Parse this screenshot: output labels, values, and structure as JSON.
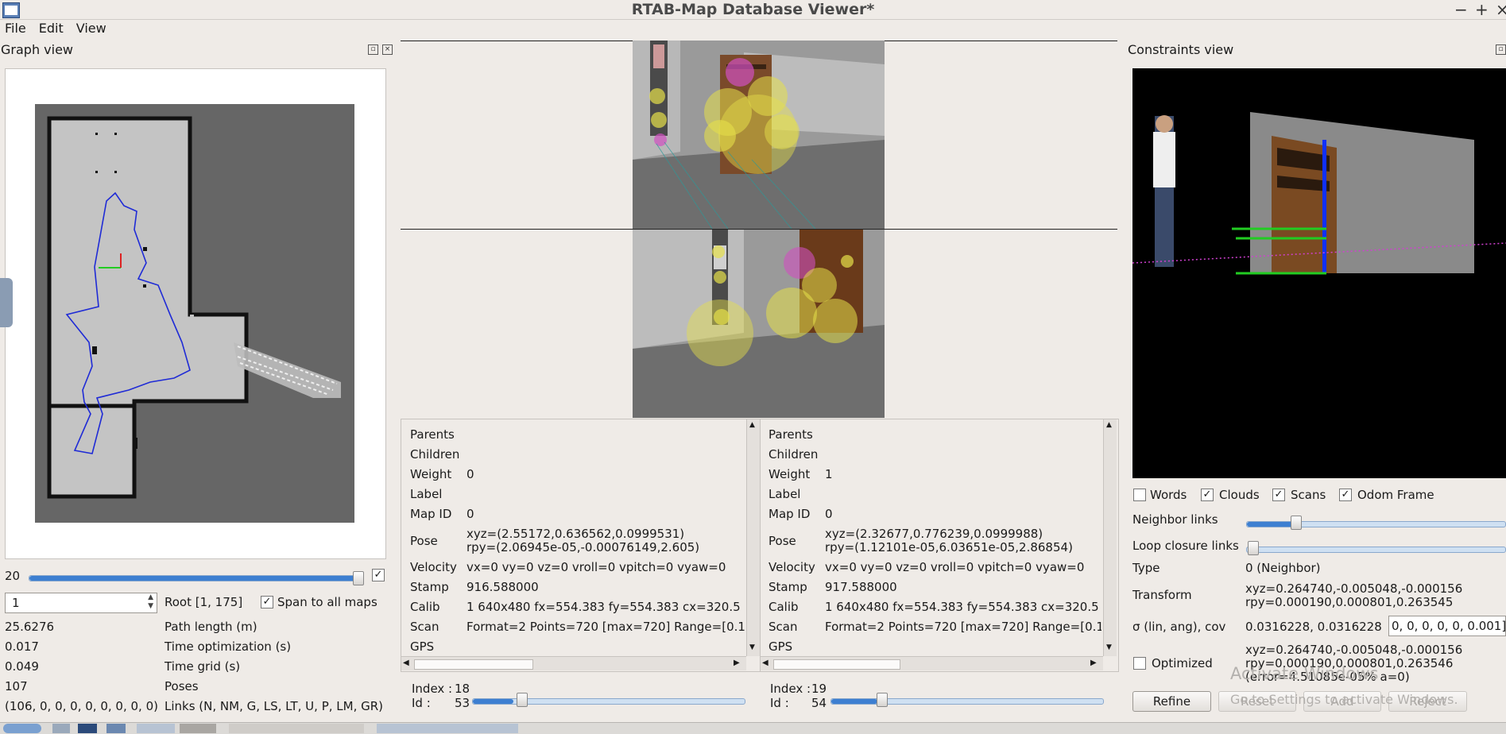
{
  "window": {
    "title": "RTAB-Map Database Viewer*",
    "controls": [
      "−",
      "+",
      "×"
    ]
  },
  "menu": {
    "items": [
      "File",
      "Edit",
      "View"
    ]
  },
  "graph_view": {
    "title": "Graph view",
    "slider_value": "20",
    "root_input_value": "1",
    "root_label": "Root [1, 175]",
    "span_label": "Span to all maps",
    "stats": [
      {
        "value": "25.6276",
        "label": "Path length (m)"
      },
      {
        "value": "0.017",
        "label": "Time optimization (s)"
      },
      {
        "value": "0.049",
        "label": "Time grid (s)"
      },
      {
        "value": "107",
        "label": "Poses"
      },
      {
        "value": "(106, 0, 0, 0, 0, 0, 0, 0, 0)",
        "label": "Links (N, NM, G, LS, LT, U, P, LM, GR)"
      }
    ]
  },
  "node_left": {
    "parents_label": "Parents",
    "children_label": "Children",
    "weight_label": "Weight",
    "weight": "0",
    "label_label": "Label",
    "mapid_label": "Map ID",
    "map_id": "0",
    "pose_label": "Pose",
    "pose_xyz": "xyz=(2.55172,0.636562,0.0999531)",
    "pose_rpy": "rpy=(2.06945e-05,-0.00076149,2.605)",
    "velocity_label": "Velocity",
    "velocity": "vx=0 vy=0 vz=0 vroll=0 vpitch=0 vyaw=0",
    "stamp_label": "Stamp",
    "stamp": "916.588000",
    "calib_label": "Calib",
    "calib": "1 640x480 fx=554.383 fy=554.383 cx=320.5",
    "scan_label": "Scan",
    "scan": "Format=2 Points=720 [max=720] Range=[0.1",
    "gps_label": "GPS",
    "index_label": "Index :",
    "index": "18",
    "id_label": "Id :",
    "id": "53"
  },
  "node_right": {
    "parents_label": "Parents",
    "children_label": "Children",
    "weight_label": "Weight",
    "weight": "1",
    "label_label": "Label",
    "mapid_label": "Map ID",
    "map_id": "0",
    "pose_label": "Pose",
    "pose_xyz": "xyz=(2.32677,0.776239,0.0999988)",
    "pose_rpy": "rpy=(1.12101e-05,6.03651e-05,2.86854)",
    "velocity_label": "Velocity",
    "velocity": "vx=0 vy=0 vz=0 vroll=0 vpitch=0 vyaw=0",
    "stamp_label": "Stamp",
    "stamp": "917.588000",
    "calib_label": "Calib",
    "calib": "1 640x480 fx=554.383 fy=554.383 cx=320.5",
    "scan_label": "Scan",
    "scan": "Format=2 Points=720 [max=720] Range=[0.1",
    "gps_label": "GPS",
    "index_label": "Index :",
    "index": "19",
    "id_label": "Id :",
    "id": "54"
  },
  "constraints": {
    "title": "Constraints view",
    "checks": [
      {
        "label": "Words",
        "checked": false
      },
      {
        "label": "Clouds",
        "checked": true
      },
      {
        "label": "Scans",
        "checked": true
      },
      {
        "label": "Odom Frame",
        "checked": true
      }
    ],
    "neighbor_links_label": "Neighbor links",
    "loop_closure_label": "Loop closure links",
    "type_label": "Type",
    "type_value": "0  (Neighbor)",
    "transform_label": "Transform",
    "transform_xyz": "xyz=0.264740,-0.005048,-0.000156",
    "transform_rpy": "rpy=0.000190,0.000801,0.263545",
    "sigma_label": "σ (lin, ang), cov",
    "sigma_value": "0.0316228, 0.0316228",
    "cov_input": "0, 0, 0, 0, 0, 0.001]",
    "optimized_label": "Optimized",
    "optimized_xyz": "xyz=0.264740,-0.005048,-0.000156",
    "optimized_rpy": "rpy=0.000190,0.000801,0.263546",
    "optimized_error": "(error=4.51085e-05% a=0)",
    "buttons": [
      "Refine",
      "Reset",
      "Add",
      "Reject"
    ],
    "watermark_line1": "Activate Windows",
    "watermark_line2": "Go to Settings to activate Windows."
  }
}
